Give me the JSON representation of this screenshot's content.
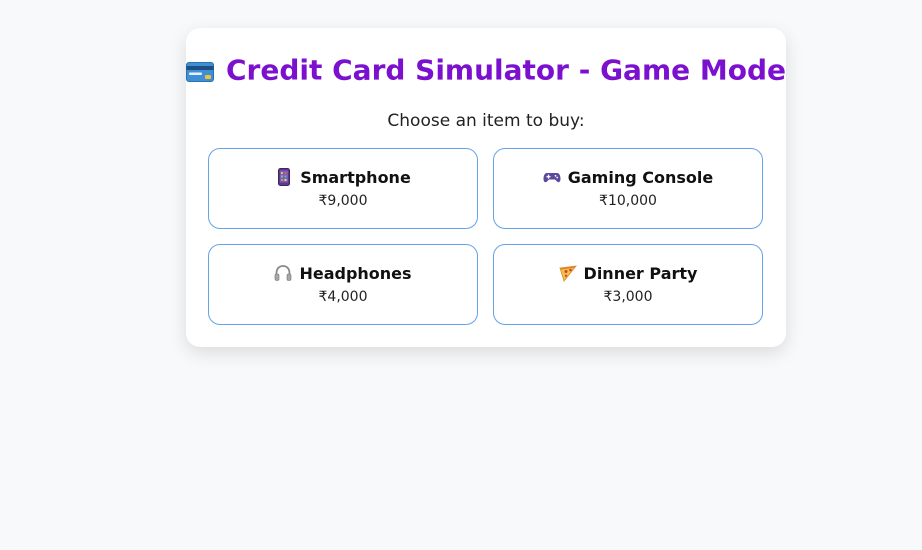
{
  "app": {
    "title": "Credit Card Simulator - Game Mode",
    "title_icon": "credit-card-icon",
    "prompt": "Choose an item to buy:"
  },
  "items": [
    {
      "name": "Smartphone",
      "price": "₹9,000",
      "icon": "smartphone-icon"
    },
    {
      "name": "Gaming Console",
      "price": "₹10,000",
      "icon": "game-controller-icon"
    },
    {
      "name": "Headphones",
      "price": "₹4,000",
      "icon": "headphones-icon"
    },
    {
      "name": "Dinner Party",
      "price": "₹3,000",
      "icon": "pizza-icon"
    }
  ],
  "colors": {
    "title": "#7c10cf",
    "item_border": "#63a4e9",
    "background": "#f8f9fb"
  }
}
